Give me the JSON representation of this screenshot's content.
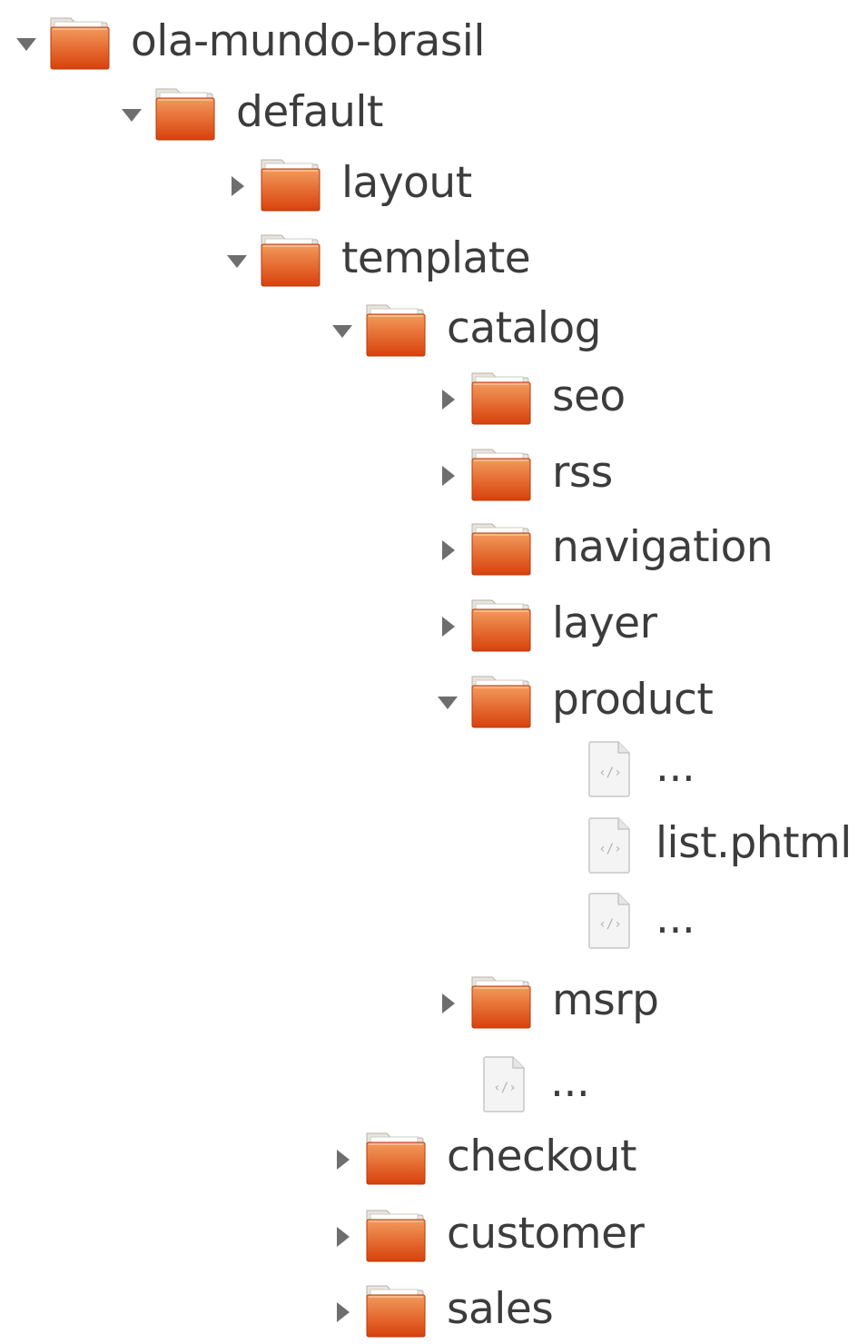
{
  "tree": {
    "nodes": [
      {
        "id": "ola-mundo-brasil",
        "label": "ola-mundo-brasil",
        "type": "folder",
        "state": "expanded",
        "depth": 0
      },
      {
        "id": "default",
        "label": "default",
        "type": "folder",
        "state": "expanded",
        "depth": 1
      },
      {
        "id": "layout",
        "label": "layout",
        "type": "folder",
        "state": "collapsed",
        "depth": 2
      },
      {
        "id": "template",
        "label": "template",
        "type": "folder",
        "state": "expanded",
        "depth": 2
      },
      {
        "id": "catalog",
        "label": "catalog",
        "type": "folder",
        "state": "expanded",
        "depth": 3
      },
      {
        "id": "seo",
        "label": "seo",
        "type": "folder",
        "state": "collapsed",
        "depth": 4
      },
      {
        "id": "rss",
        "label": "rss",
        "type": "folder",
        "state": "collapsed",
        "depth": 4
      },
      {
        "id": "navigation",
        "label": "navigation",
        "type": "folder",
        "state": "collapsed",
        "depth": 4
      },
      {
        "id": "layer",
        "label": "layer",
        "type": "folder",
        "state": "collapsed",
        "depth": 4
      },
      {
        "id": "product",
        "label": "product",
        "type": "folder",
        "state": "expanded",
        "depth": 4
      },
      {
        "id": "product-ellipsis-1",
        "label": "...",
        "type": "file",
        "depth": 5
      },
      {
        "id": "list-phtml",
        "label": "list.phtml",
        "type": "file",
        "depth": 5
      },
      {
        "id": "product-ellipsis-2",
        "label": "...",
        "type": "file",
        "depth": 5
      },
      {
        "id": "msrp",
        "label": "msrp",
        "type": "folder",
        "state": "collapsed",
        "depth": 4
      },
      {
        "id": "catalog-ellipsis",
        "label": "...",
        "type": "file",
        "depth": 4
      },
      {
        "id": "checkout",
        "label": "checkout",
        "type": "folder",
        "state": "collapsed",
        "depth": 3
      },
      {
        "id": "customer",
        "label": "customer",
        "type": "folder",
        "state": "collapsed",
        "depth": 3
      },
      {
        "id": "sales",
        "label": "sales",
        "type": "folder",
        "state": "collapsed",
        "depth": 3
      }
    ]
  },
  "icons": {
    "folder": "folder-icon",
    "file": "code-file-icon",
    "expanded": "triangle-down-icon",
    "collapsed": "triangle-right-icon"
  },
  "colors": {
    "folder_top": "#f39a5c",
    "folder_bottom": "#d8410c",
    "folder_tab": "#e8e4de",
    "text": "#3c3c3c",
    "toggle": "#6e6e6e",
    "file_border": "#c6c6c6"
  }
}
